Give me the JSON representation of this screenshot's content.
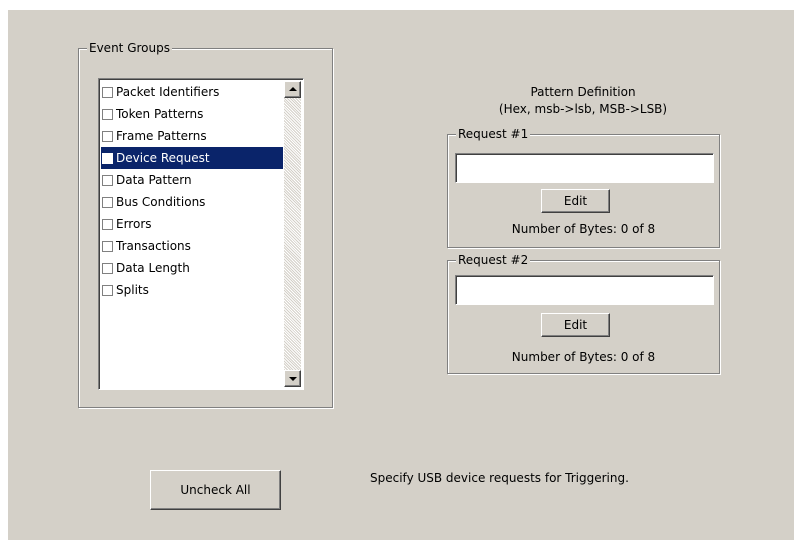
{
  "event_groups": {
    "title": "Event Groups",
    "items": [
      {
        "label": "Packet Identifiers",
        "checked": false,
        "selected": false
      },
      {
        "label": "Token Patterns",
        "checked": false,
        "selected": false
      },
      {
        "label": "Frame Patterns",
        "checked": false,
        "selected": false
      },
      {
        "label": "Device Request",
        "checked": false,
        "selected": true
      },
      {
        "label": "Data Pattern",
        "checked": false,
        "selected": false
      },
      {
        "label": "Bus Conditions",
        "checked": false,
        "selected": false
      },
      {
        "label": "Errors",
        "checked": false,
        "selected": false
      },
      {
        "label": "Transactions",
        "checked": false,
        "selected": false
      },
      {
        "label": "Data Length",
        "checked": false,
        "selected": false
      },
      {
        "label": "Splits",
        "checked": false,
        "selected": false
      }
    ]
  },
  "pattern": {
    "title_line1": "Pattern Definition",
    "title_line2": "(Hex, msb->lsb, MSB->LSB)"
  },
  "request1": {
    "title": "Request #1",
    "value": "",
    "edit_label": "Edit",
    "bytes_text": "Number of Bytes: 0 of 8"
  },
  "request2": {
    "title": "Request #2",
    "value": "",
    "edit_label": "Edit",
    "bytes_text": "Number of Bytes: 0 of 8"
  },
  "uncheck_all_label": "Uncheck All",
  "hint": "Specify USB device requests for Triggering.",
  "colors": {
    "panel_bg": "#d4d0c8",
    "selection_bg": "#0a246a",
    "selection_text": "#ffffff"
  }
}
